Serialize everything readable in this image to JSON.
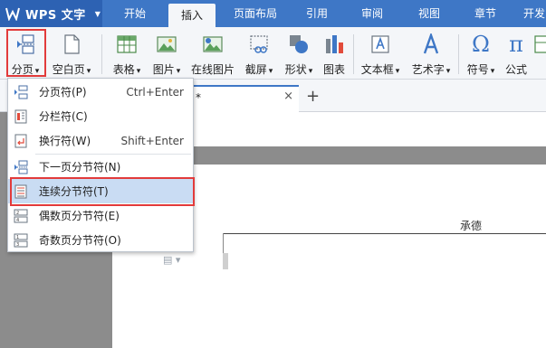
{
  "app": {
    "name": "WPS 文字"
  },
  "menu_tabs": [
    "开始",
    "插入",
    "页面布局",
    "引用",
    "审阅",
    "视图",
    "章节",
    "开发"
  ],
  "active_tab": "插入",
  "ribbon": {
    "page_break": "分页",
    "blank_page": "空白页",
    "table": "表格",
    "picture": "图片",
    "online_picture": "在线图片",
    "screenshot": "截屏",
    "shapes": "形状",
    "chart": "图表",
    "textbox": "文本框",
    "wordart": "艺术字",
    "symbol": "符号",
    "formula": "公式",
    "caret": "▾"
  },
  "document_tab": {
    "title": "*",
    "close": "×",
    "add": "+"
  },
  "dropdown": {
    "items": [
      {
        "label": "分页符(P)",
        "shortcut": "Ctrl+Enter"
      },
      {
        "label": "分栏符(C)",
        "shortcut": ""
      },
      {
        "label": "换行符(W)",
        "shortcut": "Shift+Enter"
      },
      {
        "label": "下一页分节符(N)",
        "shortcut": ""
      },
      {
        "label": "连续分节符(T)",
        "shortcut": ""
      },
      {
        "label": "偶数页分节符(E)",
        "shortcut": ""
      },
      {
        "label": "奇数页分节符(O)",
        "shortcut": ""
      }
    ]
  },
  "document": {
    "header_text": "承德"
  },
  "colors": {
    "accent": "#3e77c6",
    "highlight": "#e23b3b",
    "selected": "#c9dcf3"
  }
}
